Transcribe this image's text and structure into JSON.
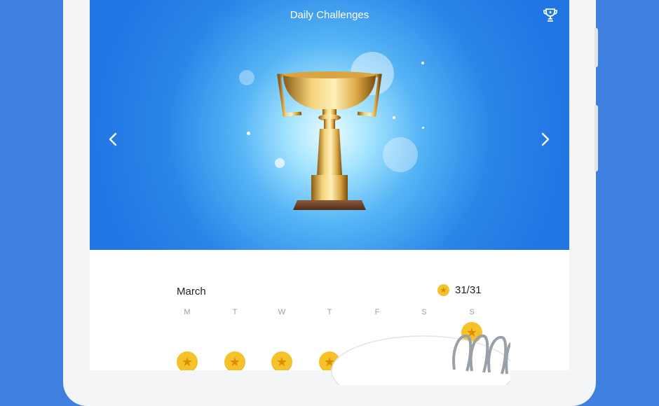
{
  "header": {
    "title": "Daily Challenges"
  },
  "calendar": {
    "month": "March",
    "progress": "31/31",
    "weekdays": [
      "M",
      "T",
      "W",
      "T",
      "F",
      "S",
      "S"
    ]
  },
  "colors": {
    "background": "#3f7fe0",
    "hero_blue": "#2b86e8",
    "coin": "#f6c22a"
  },
  "icons": {
    "top_right": "trophy-icon",
    "left": "chevron-left-icon",
    "right": "chevron-right-icon",
    "coin": "star-coin-icon"
  }
}
